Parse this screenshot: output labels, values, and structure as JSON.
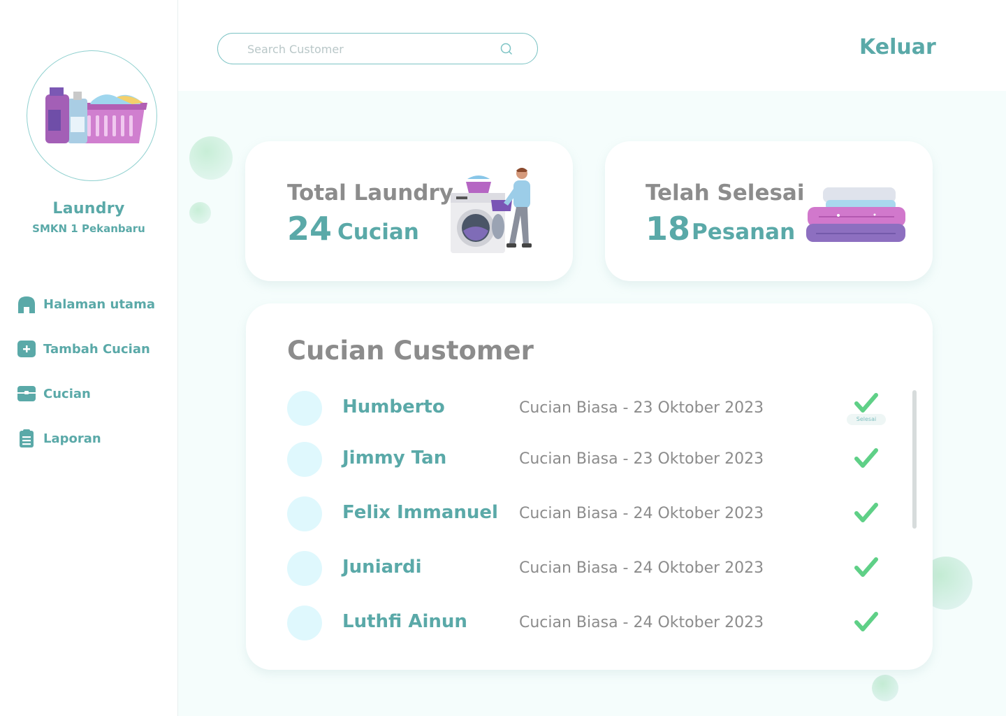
{
  "brand": {
    "title": "Laundry",
    "subtitle": "SMKN 1 Pekanbaru"
  },
  "nav": [
    {
      "label": "Halaman utama",
      "icon": "home-icon"
    },
    {
      "label": "Tambah Cucian",
      "icon": "plus-square-icon"
    },
    {
      "label": "Cucian",
      "icon": "basket-icon"
    },
    {
      "label": "Laporan",
      "icon": "clipboard-icon"
    }
  ],
  "search": {
    "placeholder": "Search Customer"
  },
  "header": {
    "logout_label": "Keluar"
  },
  "stats": {
    "total": {
      "title": "Total Laundry",
      "value": "24",
      "unit": "Cucian"
    },
    "done": {
      "title": "Telah Selesai",
      "value": "18",
      "unit": "Pesanan"
    }
  },
  "list": {
    "title": "Cucian Customer",
    "tooltip": "Selesai",
    "rows": [
      {
        "name": "Humberto",
        "desc": "Cucian Biasa - 23 Oktober 2023"
      },
      {
        "name": "Jimmy Tan",
        "desc": "Cucian Biasa - 23 Oktober 2023"
      },
      {
        "name": "Felix Immanuel",
        "desc": "Cucian Biasa - 24 Oktober 2023"
      },
      {
        "name": "Juniardi",
        "desc": "Cucian Biasa - 24 Oktober 2023"
      },
      {
        "name": "Luthfi Ainun",
        "desc": "Cucian Biasa - 24 Oktober 2023"
      }
    ]
  },
  "colors": {
    "accent": "#5aa9a8",
    "check": "#5fd087",
    "avatar": "#dff8fd",
    "background": "#f5fdfc"
  }
}
